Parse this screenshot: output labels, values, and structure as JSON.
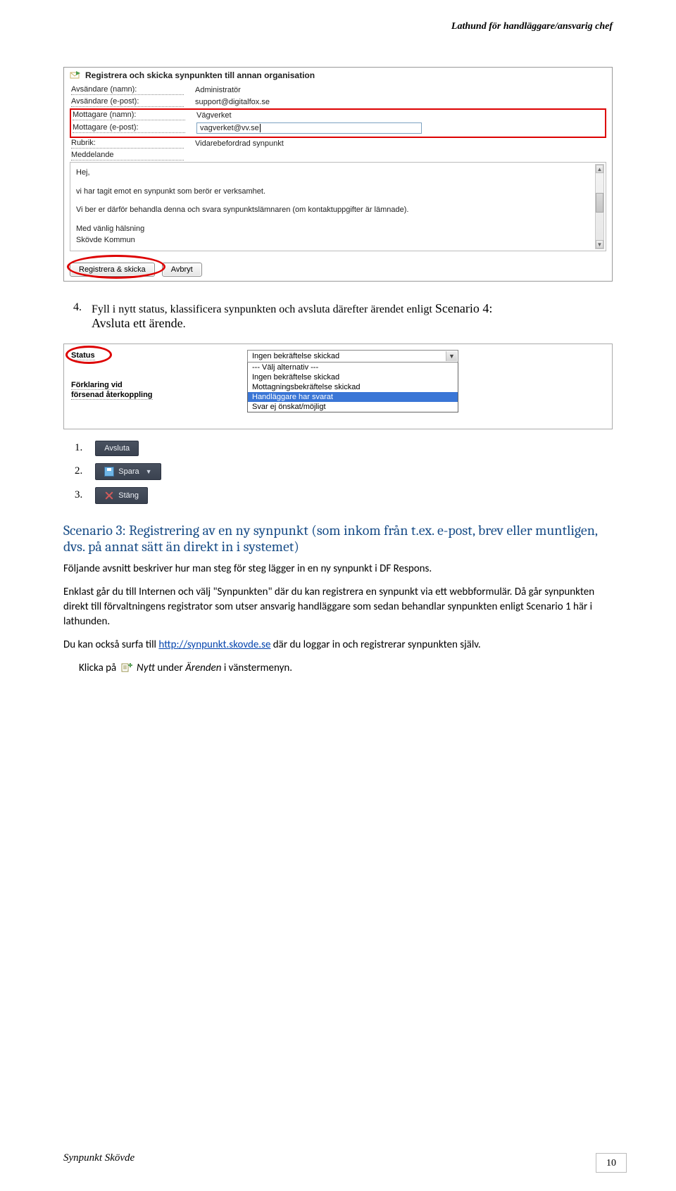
{
  "running_header": "Lathund för handläggare/ansvarig chef",
  "footer_title": "Synpunkt Skövde",
  "footer_page": "10",
  "form": {
    "title": "Registrera och skicka synpunkten till annan organisation",
    "sender_name_lbl": "Avsändare (namn):",
    "sender_name_val": "Administratör",
    "sender_mail_lbl": "Avsändare (e-post):",
    "sender_mail_val": "support@digitalfox.se",
    "rec_name_lbl": "Mottagare (namn):",
    "rec_name_val": "Vägverket",
    "rec_mail_lbl": "Mottagare (e-post):",
    "rec_mail_val": "vagverket@vv.se",
    "subject_lbl": "Rubrik:",
    "subject_val": "Vidarebefordrad synpunkt",
    "message_lbl": "Meddelande",
    "msg_l1": "Hej,",
    "msg_l2": "vi har tagit emot en synpunkt som berör er verksamhet.",
    "msg_l3": "Vi ber er därför behandla denna och svara synpunktslämnaren (om kontaktuppgifter är lämnade).",
    "msg_l4": "Med vänlig hälsning",
    "msg_l5": "Skövde Kommun",
    "btn_send": "Registrera & skicka",
    "btn_cancel": "Avbryt"
  },
  "item4": {
    "n": "4.",
    "text_a": "Fyll i nytt status, klassificera synpunkten och avsluta därefter ärendet enligt ",
    "scenario": "Scenario 4:",
    "scenario_bold": "Avsluta ett ärende",
    "trail": "."
  },
  "status": {
    "status_lbl": "Status",
    "expl_l1": "Förklaring vid",
    "expl_l2": "försenad återkoppling",
    "selected": "Ingen bekräftelse skickad",
    "options": [
      "--- Välj alternativ ---",
      "Ingen bekräftelse skickad",
      "Mottagningsbekräftelse skickad",
      "Handläggare har svarat",
      "Svar ej önskat/möjligt"
    ],
    "sel_index": 3
  },
  "small": {
    "n1": "1.",
    "n2": "2.",
    "n3": "3.",
    "b1": "Avsluta",
    "b2": "Spara",
    "b3": "Stäng"
  },
  "h3": "Scenario 3: Registrering av en ny synpunkt (som inkom från t.ex. e-post, brev eller muntligen, dvs. på annat sätt än direkt in i systemet)",
  "p1": "Följande avsnitt beskriver hur man steg för steg lägger in en ny synpunkt i DF Respons.",
  "p2": "Enklast går du till Internen och välj \"Synpunkten\" där du kan registrera en synpunkt via ett webbformulär. Då går synpunkten direkt till förvaltningens registrator som utser ansvarig handläggare som sedan behandlar synpunkten enligt Scenario 1 här i lathunden.",
  "p3a": "Du kan också surfa till ",
  "p3_link": "http://synpunkt.skovde.se",
  "p3b": " där du loggar in och registrerar synpunkten själv.",
  "p4a": "Klicka på ",
  "p4_nytt": "Nytt",
  "p4b": " under ",
  "p4_ar": "Ärenden",
  "p4c": " i vänstermenyn."
}
